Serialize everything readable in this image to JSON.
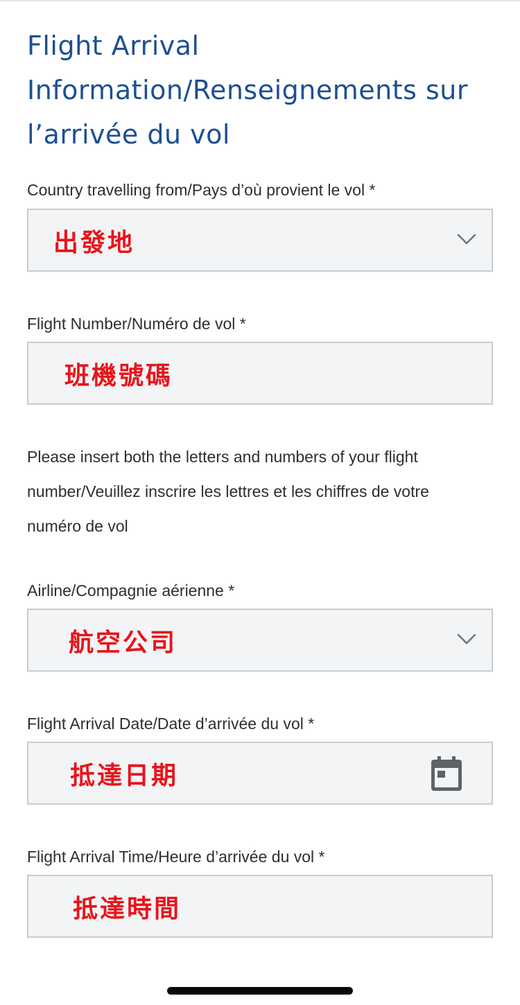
{
  "section": {
    "title": "Flight Arrival Information/Renseignements sur l’arrivée du vol"
  },
  "fields": {
    "country": {
      "label": "Country travelling from/Pays d’où provient le vol *",
      "value": "出發地",
      "icon": "chevron-down-icon"
    },
    "flight_number": {
      "label": "Flight Number/Numéro de vol *",
      "value": "班機號碼"
    },
    "airline": {
      "label": "Airline/Compagnie aérienne *",
      "value": "航空公司",
      "icon": "chevron-down-icon"
    },
    "arrival_date": {
      "label": "Flight Arrival Date/Date d’arrivée du vol *",
      "value": "抵達日期",
      "icon": "calendar-icon"
    },
    "arrival_time": {
      "label": "Flight Arrival Time/Heure d’arrivée du vol *",
      "value": "抵達時間"
    }
  },
  "help_text": {
    "flight_number": "Please insert both the letters and numbers of your flight number/Veuillez inscrire les lettres et les chiffres de votre numéro de vol"
  },
  "colors": {
    "title": "#1d4f91",
    "annotation": "#e8141b",
    "field_background": "#f3f4f6",
    "field_border": "#c9cccf",
    "icon": "#707579"
  }
}
